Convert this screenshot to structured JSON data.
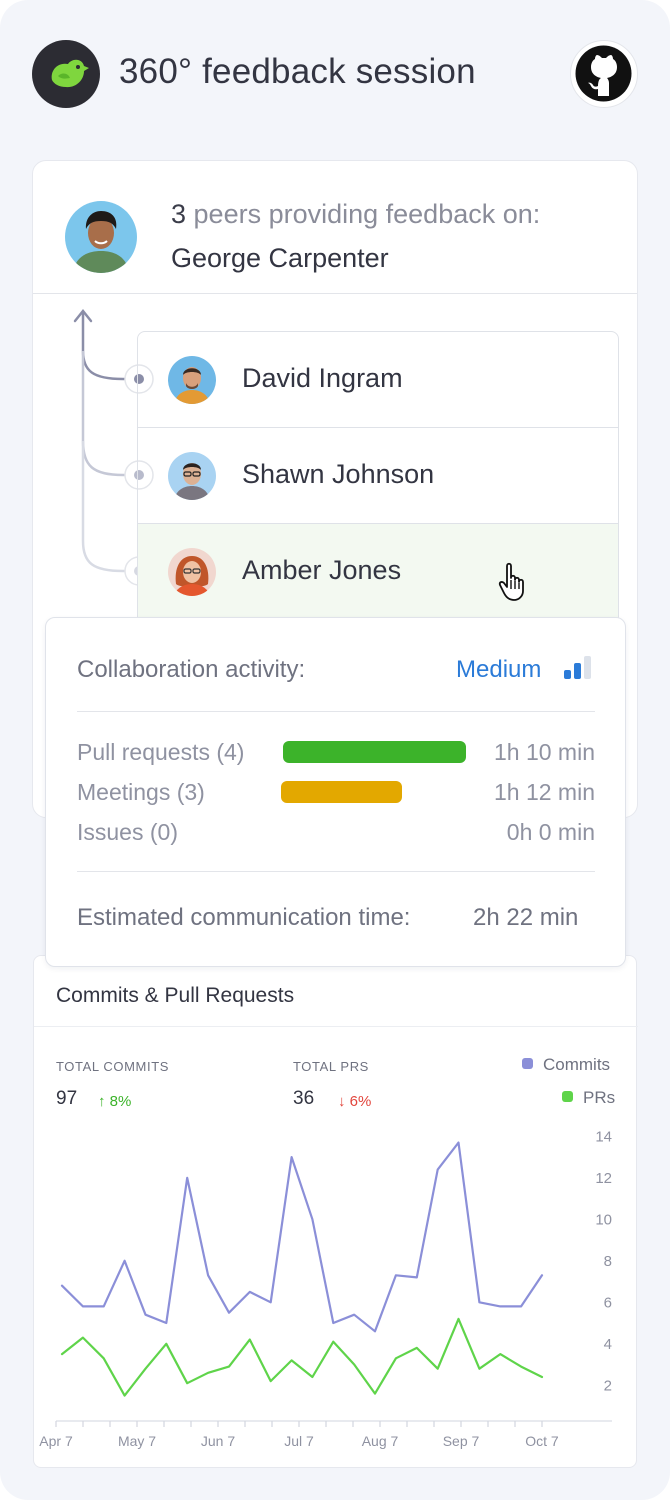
{
  "header": {
    "title": "360° feedback session",
    "logo_icon": "bird-logo-icon",
    "github_icon": "github-icon"
  },
  "subject": {
    "count": "3",
    "line1_rest": " peers providing feedback on:",
    "name": "George Carpenter"
  },
  "peers": [
    {
      "name": "David Ingram",
      "active": false
    },
    {
      "name": "Shawn Johnson",
      "active": false
    },
    {
      "name": "Amber Jones",
      "active": true
    }
  ],
  "collaboration": {
    "label": "Collaboration activity:",
    "level": "Medium",
    "level_color": "#2b7bd8",
    "activities": [
      {
        "label": "Pull requests (4)",
        "time": "1h 10 min",
        "fill": 1.0,
        "color": "#3cb32a"
      },
      {
        "label": "Meetings (3)",
        "time": "1h 12 min",
        "fill": 0.66,
        "color": "#e3a800"
      },
      {
        "label": "Issues (0)",
        "time": "0h 0 min",
        "fill": 0,
        "color": "#cccccc"
      }
    ],
    "estimate_label": "Estimated communication time:",
    "estimate_value": "2h 22 min"
  },
  "chart": {
    "title": "Commits & Pull Requests",
    "total_commits_label": "TOTAL COMMITS",
    "total_commits_value": "97",
    "total_commits_delta": "↑ 8%",
    "total_prs_label": "TOTAL PRS",
    "total_prs_value": "36",
    "total_prs_delta": "↓ 6%",
    "up_color": "#3cb32a",
    "down_color": "#e2453c"
  },
  "chart_data": {
    "type": "line",
    "x": [
      "Apr 7",
      "",
      "",
      "May 7",
      "",
      "",
      "Jun 7",
      "",
      "",
      "Jul 7",
      "",
      "",
      "Aug 7",
      "",
      "",
      "Sep 7",
      "",
      "",
      "Oct 7"
    ],
    "x_tick_labels": [
      "Apr 7",
      "May 7",
      "Jun 7",
      "Jul 7",
      "Aug 7",
      "Sep 7",
      "Oct 7"
    ],
    "y_ticks": [
      2,
      4,
      6,
      8,
      10,
      12,
      14
    ],
    "ylim": [
      1,
      14.5
    ],
    "legend_position": "top-right",
    "series": [
      {
        "name": "Commits",
        "color": "#8b8fd8",
        "values": [
          6.8,
          5.8,
          5.8,
          8.0,
          5.4,
          5.0,
          12.0,
          7.3,
          5.5,
          6.5,
          6.0,
          13.0,
          10.0,
          5.0,
          5.4,
          4.6,
          7.3,
          7.2,
          12.4,
          13.7,
          6.0,
          5.8,
          5.8,
          7.3
        ]
      },
      {
        "name": "PRs",
        "color": "#5fd44a",
        "values": [
          3.5,
          4.3,
          3.3,
          1.5,
          2.8,
          4.0,
          2.1,
          2.6,
          2.9,
          4.2,
          2.2,
          3.2,
          2.4,
          4.1,
          3.0,
          1.6,
          3.3,
          3.8,
          2.8,
          5.2,
          2.8,
          3.5,
          2.9,
          2.4
        ]
      }
    ]
  }
}
